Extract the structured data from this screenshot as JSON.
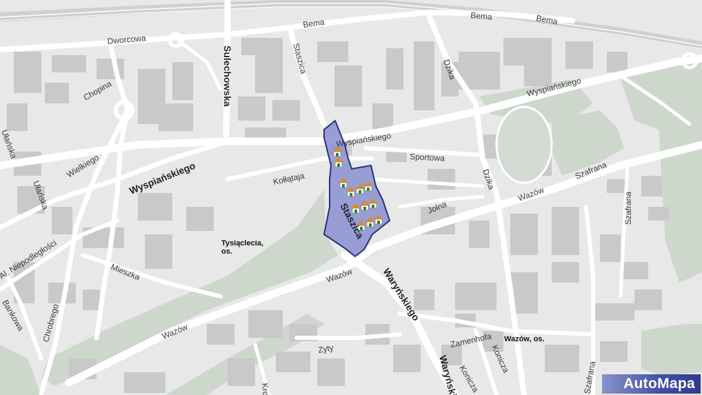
{
  "map": {
    "streets": {
      "bema_1": "Bema",
      "bema_2": "Bema",
      "bema_3": "Bema",
      "dworcowa": "Dworcowa",
      "sulechowska": "Sulechowska",
      "staszica_north": "Staszica",
      "dzika_north": "Dzika",
      "dzika_south": "Dzika",
      "chopina": "Chopina",
      "wyspianskiego_west": "Wyspiańskiego",
      "wyspianskiego_center": "Wyspiańskiego",
      "wyspianskiego_east": "Wyspiańskiego",
      "sportowa": "Sportowa",
      "wielkiego": "Wielkiego",
      "kollataja": "Kołłątaja",
      "ulanska_1": "Ułańska",
      "ulanska_2": "Ułańska",
      "staszica_area": "Staszica",
      "jolna": "Jolna",
      "wazow_east": "Wazów",
      "wazow_center": "Wazów",
      "wazow_west": "Wazów",
      "szafrana_1": "Szafrana",
      "szafrana_2": "Szafrana",
      "szafrana_3": "Szafrana",
      "niepodleglosci": "Al. Niepodległości",
      "mieszka": "Mieszka",
      "chrobrego": "Chrobrego",
      "bankowa": "Bankowa",
      "warynskiego_1": "Waryńskiego",
      "warynskiego_2": "Waryńskiego",
      "zamenhofa": "Zamenhofa",
      "konicza_1": "Konicza",
      "konicza_2": "Konicza",
      "zyty": "Zyty",
      "krochmalna": "Kro"
    },
    "places": {
      "tysiaclecia": "Tysiąclecia, os.",
      "wazow_estate": "Wazów, os."
    },
    "area_name": "Staszica",
    "logo": "AutoMapa",
    "colors": {
      "background": "#e6e6e6",
      "road": "#ffffff",
      "building": "#c9c9c9",
      "park": "#c8d3c8",
      "area_fill": "#8a8fd0",
      "area_stroke": "#28307a"
    }
  }
}
